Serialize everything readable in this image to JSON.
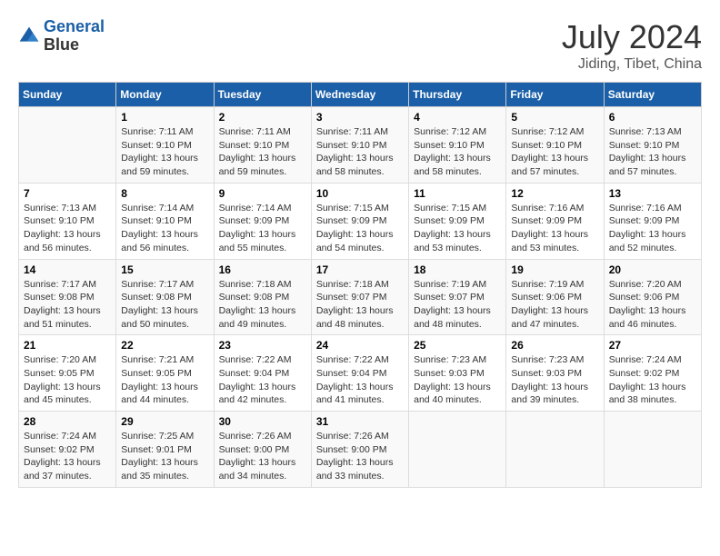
{
  "header": {
    "logo_line1": "General",
    "logo_line2": "Blue",
    "month_year": "July 2024",
    "location": "Jiding, Tibet, China"
  },
  "days_of_week": [
    "Sunday",
    "Monday",
    "Tuesday",
    "Wednesday",
    "Thursday",
    "Friday",
    "Saturday"
  ],
  "weeks": [
    [
      {
        "day": "",
        "sunrise": "",
        "sunset": "",
        "daylight": ""
      },
      {
        "day": "1",
        "sunrise": "Sunrise: 7:11 AM",
        "sunset": "Sunset: 9:10 PM",
        "daylight": "Daylight: 13 hours and 59 minutes."
      },
      {
        "day": "2",
        "sunrise": "Sunrise: 7:11 AM",
        "sunset": "Sunset: 9:10 PM",
        "daylight": "Daylight: 13 hours and 59 minutes."
      },
      {
        "day": "3",
        "sunrise": "Sunrise: 7:11 AM",
        "sunset": "Sunset: 9:10 PM",
        "daylight": "Daylight: 13 hours and 58 minutes."
      },
      {
        "day": "4",
        "sunrise": "Sunrise: 7:12 AM",
        "sunset": "Sunset: 9:10 PM",
        "daylight": "Daylight: 13 hours and 58 minutes."
      },
      {
        "day": "5",
        "sunrise": "Sunrise: 7:12 AM",
        "sunset": "Sunset: 9:10 PM",
        "daylight": "Daylight: 13 hours and 57 minutes."
      },
      {
        "day": "6",
        "sunrise": "Sunrise: 7:13 AM",
        "sunset": "Sunset: 9:10 PM",
        "daylight": "Daylight: 13 hours and 57 minutes."
      }
    ],
    [
      {
        "day": "7",
        "sunrise": "Sunrise: 7:13 AM",
        "sunset": "Sunset: 9:10 PM",
        "daylight": "Daylight: 13 hours and 56 minutes."
      },
      {
        "day": "8",
        "sunrise": "Sunrise: 7:14 AM",
        "sunset": "Sunset: 9:10 PM",
        "daylight": "Daylight: 13 hours and 56 minutes."
      },
      {
        "day": "9",
        "sunrise": "Sunrise: 7:14 AM",
        "sunset": "Sunset: 9:09 PM",
        "daylight": "Daylight: 13 hours and 55 minutes."
      },
      {
        "day": "10",
        "sunrise": "Sunrise: 7:15 AM",
        "sunset": "Sunset: 9:09 PM",
        "daylight": "Daylight: 13 hours and 54 minutes."
      },
      {
        "day": "11",
        "sunrise": "Sunrise: 7:15 AM",
        "sunset": "Sunset: 9:09 PM",
        "daylight": "Daylight: 13 hours and 53 minutes."
      },
      {
        "day": "12",
        "sunrise": "Sunrise: 7:16 AM",
        "sunset": "Sunset: 9:09 PM",
        "daylight": "Daylight: 13 hours and 53 minutes."
      },
      {
        "day": "13",
        "sunrise": "Sunrise: 7:16 AM",
        "sunset": "Sunset: 9:09 PM",
        "daylight": "Daylight: 13 hours and 52 minutes."
      }
    ],
    [
      {
        "day": "14",
        "sunrise": "Sunrise: 7:17 AM",
        "sunset": "Sunset: 9:08 PM",
        "daylight": "Daylight: 13 hours and 51 minutes."
      },
      {
        "day": "15",
        "sunrise": "Sunrise: 7:17 AM",
        "sunset": "Sunset: 9:08 PM",
        "daylight": "Daylight: 13 hours and 50 minutes."
      },
      {
        "day": "16",
        "sunrise": "Sunrise: 7:18 AM",
        "sunset": "Sunset: 9:08 PM",
        "daylight": "Daylight: 13 hours and 49 minutes."
      },
      {
        "day": "17",
        "sunrise": "Sunrise: 7:18 AM",
        "sunset": "Sunset: 9:07 PM",
        "daylight": "Daylight: 13 hours and 48 minutes."
      },
      {
        "day": "18",
        "sunrise": "Sunrise: 7:19 AM",
        "sunset": "Sunset: 9:07 PM",
        "daylight": "Daylight: 13 hours and 48 minutes."
      },
      {
        "day": "19",
        "sunrise": "Sunrise: 7:19 AM",
        "sunset": "Sunset: 9:06 PM",
        "daylight": "Daylight: 13 hours and 47 minutes."
      },
      {
        "day": "20",
        "sunrise": "Sunrise: 7:20 AM",
        "sunset": "Sunset: 9:06 PM",
        "daylight": "Daylight: 13 hours and 46 minutes."
      }
    ],
    [
      {
        "day": "21",
        "sunrise": "Sunrise: 7:20 AM",
        "sunset": "Sunset: 9:05 PM",
        "daylight": "Daylight: 13 hours and 45 minutes."
      },
      {
        "day": "22",
        "sunrise": "Sunrise: 7:21 AM",
        "sunset": "Sunset: 9:05 PM",
        "daylight": "Daylight: 13 hours and 44 minutes."
      },
      {
        "day": "23",
        "sunrise": "Sunrise: 7:22 AM",
        "sunset": "Sunset: 9:04 PM",
        "daylight": "Daylight: 13 hours and 42 minutes."
      },
      {
        "day": "24",
        "sunrise": "Sunrise: 7:22 AM",
        "sunset": "Sunset: 9:04 PM",
        "daylight": "Daylight: 13 hours and 41 minutes."
      },
      {
        "day": "25",
        "sunrise": "Sunrise: 7:23 AM",
        "sunset": "Sunset: 9:03 PM",
        "daylight": "Daylight: 13 hours and 40 minutes."
      },
      {
        "day": "26",
        "sunrise": "Sunrise: 7:23 AM",
        "sunset": "Sunset: 9:03 PM",
        "daylight": "Daylight: 13 hours and 39 minutes."
      },
      {
        "day": "27",
        "sunrise": "Sunrise: 7:24 AM",
        "sunset": "Sunset: 9:02 PM",
        "daylight": "Daylight: 13 hours and 38 minutes."
      }
    ],
    [
      {
        "day": "28",
        "sunrise": "Sunrise: 7:24 AM",
        "sunset": "Sunset: 9:02 PM",
        "daylight": "Daylight: 13 hours and 37 minutes."
      },
      {
        "day": "29",
        "sunrise": "Sunrise: 7:25 AM",
        "sunset": "Sunset: 9:01 PM",
        "daylight": "Daylight: 13 hours and 35 minutes."
      },
      {
        "day": "30",
        "sunrise": "Sunrise: 7:26 AM",
        "sunset": "Sunset: 9:00 PM",
        "daylight": "Daylight: 13 hours and 34 minutes."
      },
      {
        "day": "31",
        "sunrise": "Sunrise: 7:26 AM",
        "sunset": "Sunset: 9:00 PM",
        "daylight": "Daylight: 13 hours and 33 minutes."
      },
      {
        "day": "",
        "sunrise": "",
        "sunset": "",
        "daylight": ""
      },
      {
        "day": "",
        "sunrise": "",
        "sunset": "",
        "daylight": ""
      },
      {
        "day": "",
        "sunrise": "",
        "sunset": "",
        "daylight": ""
      }
    ]
  ]
}
